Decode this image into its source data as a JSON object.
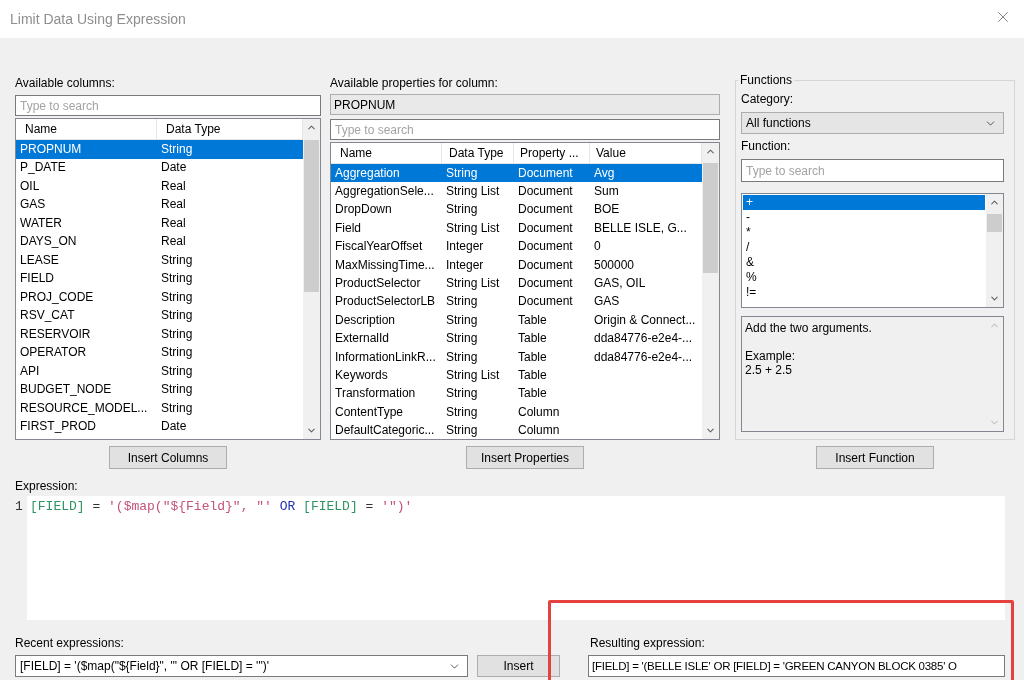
{
  "window": {
    "title": "Limit Data Using Expression"
  },
  "columns_panel": {
    "label": "Available columns:",
    "search": {
      "placeholder": "Type to search"
    },
    "table": {
      "columns": [
        "Name",
        "Data Type"
      ],
      "rows": [
        {
          "cells": [
            "PROPNUM",
            "String"
          ],
          "selected": true
        },
        {
          "cells": [
            "P_DATE",
            "Date"
          ],
          "selected": false
        },
        {
          "cells": [
            "OIL",
            "Real"
          ],
          "selected": false
        },
        {
          "cells": [
            "GAS",
            "Real"
          ],
          "selected": false
        },
        {
          "cells": [
            "WATER",
            "Real"
          ],
          "selected": false
        },
        {
          "cells": [
            "DAYS_ON",
            "Real"
          ],
          "selected": false
        },
        {
          "cells": [
            "LEASE",
            "String"
          ],
          "selected": false
        },
        {
          "cells": [
            "FIELD",
            "String"
          ],
          "selected": false
        },
        {
          "cells": [
            "PROJ_CODE",
            "String"
          ],
          "selected": false
        },
        {
          "cells": [
            "RSV_CAT",
            "String"
          ],
          "selected": false
        },
        {
          "cells": [
            "RESERVOIR",
            "String"
          ],
          "selected": false
        },
        {
          "cells": [
            "OPERATOR",
            "String"
          ],
          "selected": false
        },
        {
          "cells": [
            "API",
            "String"
          ],
          "selected": false
        },
        {
          "cells": [
            "BUDGET_NODE",
            "String"
          ],
          "selected": false
        },
        {
          "cells": [
            "RESOURCE_MODEL...",
            "String"
          ],
          "selected": false
        },
        {
          "cells": [
            "FIRST_PROD",
            "Date"
          ],
          "selected": false
        }
      ]
    },
    "button": "Insert Columns"
  },
  "properties_panel": {
    "label": "Available properties for column:",
    "column": "PROPNUM",
    "search": {
      "placeholder": "Type to search"
    },
    "table": {
      "columns": [
        "Name",
        "Data Type",
        "Property ...",
        "Value"
      ],
      "rows": [
        {
          "cells": [
            "Aggregation",
            "String",
            "Document",
            "Avg"
          ],
          "selected": true
        },
        {
          "cells": [
            "AggregationSele...",
            "String List",
            "Document",
            "Sum"
          ],
          "selected": false
        },
        {
          "cells": [
            "DropDown",
            "String",
            "Document",
            "BOE"
          ],
          "selected": false
        },
        {
          "cells": [
            "Field",
            "String List",
            "Document",
            "BELLE ISLE, G..."
          ],
          "selected": false
        },
        {
          "cells": [
            "FiscalYearOffset",
            "Integer",
            "Document",
            "0"
          ],
          "selected": false
        },
        {
          "cells": [
            "MaxMissingTime...",
            "Integer",
            "Document",
            "500000"
          ],
          "selected": false
        },
        {
          "cells": [
            "ProductSelector",
            "String List",
            "Document",
            "GAS, OIL"
          ],
          "selected": false
        },
        {
          "cells": [
            "ProductSelectorLB",
            "String",
            "Document",
            "GAS"
          ],
          "selected": false
        },
        {
          "cells": [
            "Description",
            "String",
            "Table",
            "Origin & Connect..."
          ],
          "selected": false
        },
        {
          "cells": [
            "ExternalId",
            "String",
            "Table",
            "dda84776-e2e4-..."
          ],
          "selected": false
        },
        {
          "cells": [
            "InformationLinkR...",
            "String",
            "Table",
            "dda84776-e2e4-..."
          ],
          "selected": false
        },
        {
          "cells": [
            "Keywords",
            "String List",
            "Table"
          ],
          "selected": false
        },
        {
          "cells": [
            "Transformation",
            "String",
            "Table"
          ],
          "selected": false
        },
        {
          "cells": [
            "ContentType",
            "String",
            "Column"
          ],
          "selected": false
        },
        {
          "cells": [
            "DefaultCategoric...",
            "String",
            "Column"
          ],
          "selected": false
        }
      ]
    },
    "button": "Insert Properties"
  },
  "functions_panel": {
    "title": "Functions",
    "category_label": "Category:",
    "category": "All functions",
    "function_label": "Function:",
    "search": {
      "placeholder": "Type to search"
    },
    "items": [
      {
        "label": "+",
        "selected": true
      },
      {
        "label": "-",
        "selected": false
      },
      {
        "label": "*",
        "selected": false
      },
      {
        "label": "/",
        "selected": false
      },
      {
        "label": "&",
        "selected": false
      },
      {
        "label": "%",
        "selected": false
      },
      {
        "label": "!=",
        "selected": false
      }
    ],
    "description": {
      "summary": "Add the two arguments.",
      "example_label": "Example:",
      "example": "2.5 + 2.5"
    },
    "button": "Insert Function"
  },
  "expression": {
    "label": "Expression:",
    "line_number": "1",
    "tokens": [
      {
        "kind": "column",
        "text": "[FIELD]"
      },
      {
        "kind": "operator",
        "text": "="
      },
      {
        "kind": "string",
        "text": "'($map(\"${Field}\", \"'"
      },
      {
        "kind": "keyword",
        "text": "OR"
      },
      {
        "kind": "column",
        "text": "[FIELD]"
      },
      {
        "kind": "operator",
        "text": "="
      },
      {
        "kind": "string",
        "text": "'\")'"
      }
    ]
  },
  "recent_expressions": {
    "label": "Recent expressions:",
    "value": "[FIELD] = '($map(\"${Field}\", \"' OR [FIELD] = '\")'",
    "button": "Insert"
  },
  "resulting_expression": {
    "label": "Resulting expression:",
    "value": "[FIELD] = '(BELLE ISLE' OR [FIELD] = 'GREEN CANYON BLOCK 0385' O",
    "highlighted": true
  }
}
